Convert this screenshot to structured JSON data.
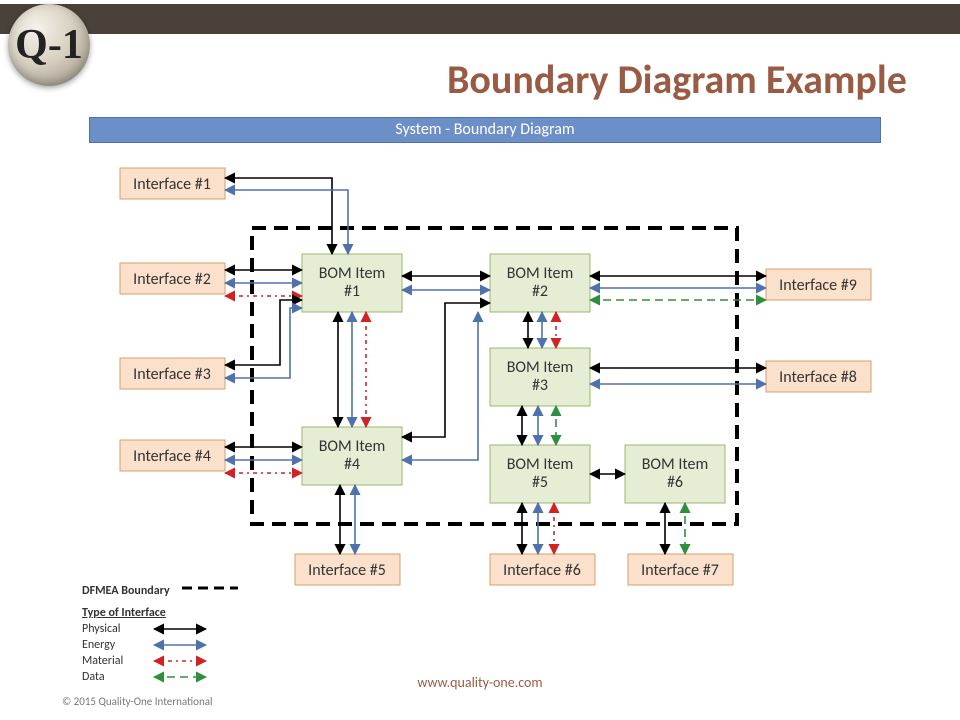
{
  "logo": {
    "text": "Q-1"
  },
  "title": "Boundary Diagram Example",
  "banner": "System - Boundary Diagram",
  "url": "www.quality-one.com",
  "copyright": "© 2015 Quality-One International",
  "legend": {
    "boundary_label": "DFMEA Boundary",
    "type_heading": "Type of Interface",
    "rows": {
      "physical": "Physical",
      "energy": "Energy",
      "material": "Material",
      "data": "Data"
    }
  },
  "nodes": {
    "if1": "Interface #1",
    "if2": "Interface #2",
    "if3": "Interface #3",
    "if4": "Interface #4",
    "if5": "Interface #5",
    "if6": "Interface #6",
    "if7": "Interface #7",
    "if8": "Interface #8",
    "if9": "Interface #9",
    "bom1": "BOM Item\n#1",
    "bom2": "BOM Item\n#2",
    "bom3": "BOM Item\n#3",
    "bom4": "BOM Item\n#4",
    "bom5": "BOM Item\n#5",
    "bom6": "BOM Item\n#6"
  },
  "interface_colors": {
    "physical": "#000000",
    "energy": "#4F72AC",
    "material": "#D02424",
    "data": "#2E8F3F"
  }
}
